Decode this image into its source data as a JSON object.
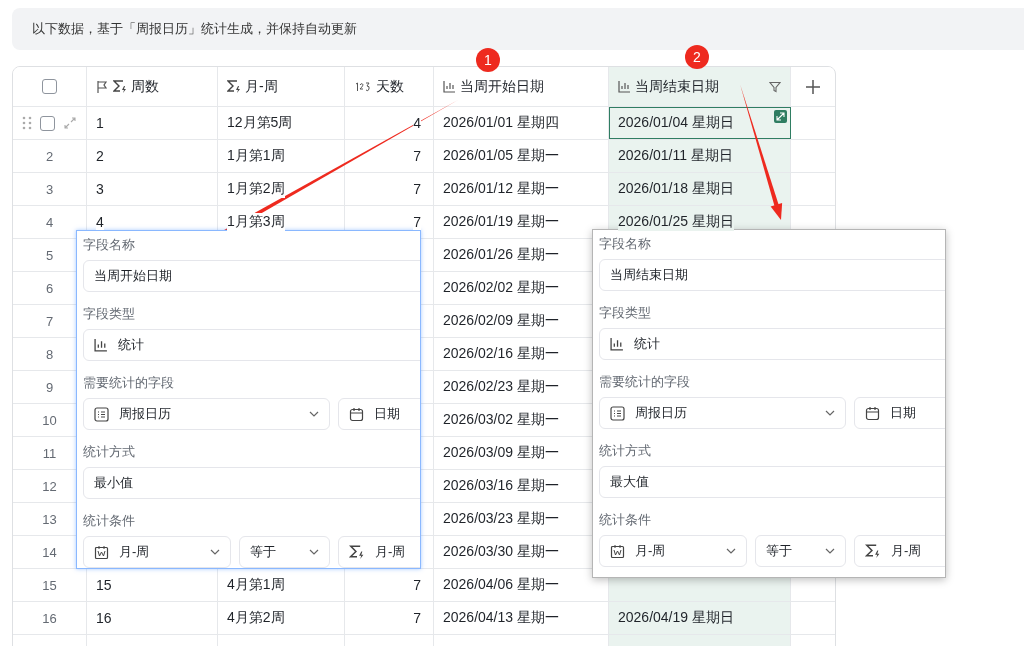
{
  "notice": "以下数据，基于「周报日历」统计生成，并保持自动更新",
  "table": {
    "columns": [
      {
        "label": "周数",
        "kind": "primary-formula",
        "selected": false,
        "filter": false
      },
      {
        "label": "月-周",
        "kind": "formula",
        "selected": false,
        "filter": false
      },
      {
        "label": "天数",
        "kind": "number",
        "selected": false,
        "filter": false
      },
      {
        "label": "当周开始日期",
        "kind": "stat",
        "selected": false,
        "filter": false
      },
      {
        "label": "当周结束日期",
        "kind": "stat",
        "selected": true,
        "filter": true
      }
    ],
    "rows": [
      {
        "hovered": true,
        "checked": false,
        "cells": [
          "1",
          "12月第5周",
          "4",
          "2026/01/01 星期四",
          "2026/01/04 星期日"
        ],
        "end_selected": true
      },
      {
        "hovered": false,
        "checked": false,
        "index": "2",
        "cells": [
          "2",
          "1月第1周",
          "7",
          "2026/01/05 星期一",
          "2026/01/11 星期日"
        ],
        "end_selected": false
      },
      {
        "hovered": false,
        "checked": false,
        "index": "3",
        "cells": [
          "3",
          "1月第2周",
          "7",
          "2026/01/12 星期一",
          "2026/01/18 星期日"
        ],
        "end_selected": false
      },
      {
        "hovered": false,
        "checked": false,
        "index": "4",
        "cells": [
          "4",
          "1月第3周",
          "7",
          "2026/01/19 星期一",
          "2026/01/25 星期日"
        ],
        "end_selected": false
      },
      {
        "hovered": false,
        "checked": false,
        "index": "5",
        "cells": [
          null,
          null,
          null,
          "2026/01/26 星期一",
          null
        ]
      },
      {
        "hovered": false,
        "checked": false,
        "index": "6",
        "cells": [
          null,
          null,
          null,
          "2026/02/02 星期一",
          null
        ]
      },
      {
        "hovered": false,
        "checked": false,
        "index": "7",
        "cells": [
          null,
          null,
          null,
          "2026/02/09 星期一",
          null
        ]
      },
      {
        "hovered": false,
        "checked": false,
        "index": "8",
        "cells": [
          null,
          null,
          null,
          "2026/02/16 星期一",
          null
        ]
      },
      {
        "hovered": false,
        "checked": false,
        "index": "9",
        "cells": [
          null,
          null,
          null,
          "2026/02/23 星期一",
          null
        ]
      },
      {
        "hovered": false,
        "checked": false,
        "index": "10",
        "cells": [
          null,
          null,
          null,
          "2026/03/02 星期一",
          null
        ]
      },
      {
        "hovered": false,
        "checked": false,
        "index": "11",
        "cells": [
          null,
          null,
          null,
          "2026/03/09 星期一",
          null
        ]
      },
      {
        "hovered": false,
        "checked": false,
        "index": "12",
        "cells": [
          null,
          null,
          null,
          "2026/03/16 星期一",
          null
        ]
      },
      {
        "hovered": false,
        "checked": false,
        "index": "13",
        "cells": [
          null,
          null,
          null,
          "2026/03/23 星期一",
          null
        ]
      },
      {
        "hovered": false,
        "checked": false,
        "index": "14",
        "cells": [
          null,
          null,
          null,
          "2026/03/30 星期一",
          null
        ]
      },
      {
        "hovered": false,
        "checked": false,
        "index": "15",
        "cells": [
          "15",
          "4月第1周",
          "7",
          "2026/04/06 星期一",
          null
        ]
      },
      {
        "hovered": false,
        "checked": false,
        "index": "16",
        "cells": [
          "16",
          "4月第2周",
          "7",
          "2026/04/13 星期一",
          "2026/04/19 星期日"
        ],
        "end_selected": false
      }
    ]
  },
  "popovers": [
    {
      "focused": true,
      "name_label": "字段名称",
      "name": "当周开始日期",
      "type_label": "字段类型",
      "type": "统计",
      "source_label": "需要统计的字段",
      "source_table": "周报日历",
      "source_field": "日期",
      "method_label": "统计方式",
      "method": "最小值",
      "condition_label": "统计条件",
      "condition_field": "月-周",
      "condition_operator": "等于",
      "condition_value": "月-周"
    },
    {
      "focused": false,
      "name_label": "字段名称",
      "name": "当周结束日期",
      "type_label": "字段类型",
      "type": "统计",
      "source_label": "需要统计的字段",
      "source_table": "周报日历",
      "source_field": "日期",
      "method_label": "统计方式",
      "method": "最大值",
      "condition_label": "统计条件",
      "condition_field": "月-周",
      "condition_operator": "等于",
      "condition_value": "月-周"
    }
  ],
  "select_all_checked": false,
  "annotations": [
    {
      "label": "1"
    },
    {
      "label": "2"
    }
  ]
}
